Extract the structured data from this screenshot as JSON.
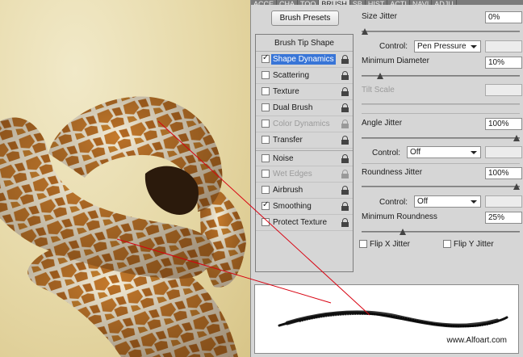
{
  "tabs": [
    "ACCE",
    "CHA",
    "TOO",
    "BRUSH",
    "SB",
    "HIST",
    "ACTI",
    "NAVI",
    "ADJU"
  ],
  "active_tab": "BRUSH",
  "brush_presets_label": "Brush Presets",
  "list": {
    "title": "Brush Tip Shape",
    "items": [
      {
        "label": "Shape Dynamics",
        "checked": true
      },
      {
        "label": "Scattering",
        "checked": false
      },
      {
        "label": "Texture",
        "checked": false
      },
      {
        "label": "Dual Brush",
        "checked": false
      },
      {
        "label": "Color Dynamics",
        "checked": false
      },
      {
        "label": "Transfer",
        "checked": false
      },
      {
        "label": "Noise",
        "checked": false
      },
      {
        "label": "Wet Edges",
        "checked": false
      },
      {
        "label": "Airbrush",
        "checked": false
      },
      {
        "label": "Smoothing",
        "checked": true
      },
      {
        "label": "Protect Texture",
        "checked": false
      }
    ]
  },
  "controls": {
    "size_jitter": {
      "label": "Size Jitter",
      "value": "0%",
      "slider": 0.0
    },
    "control_label": "Control:",
    "control_size": "Pen Pressure",
    "min_diameter": {
      "label": "Minimum Diameter",
      "value": "10%",
      "slider": 0.1
    },
    "tilt_scale": {
      "label": "Tilt Scale"
    },
    "angle_jitter": {
      "label": "Angle Jitter",
      "value": "100%",
      "slider": 1.0
    },
    "control_angle": "Off",
    "roundness_jitter": {
      "label": "Roundness Jitter",
      "value": "100%",
      "slider": 1.0
    },
    "control_roundness": "Off",
    "min_roundness": {
      "label": "Minimum Roundness",
      "value": "25%",
      "slider": 0.25
    },
    "flip_x": "Flip X Jitter",
    "flip_y": "Flip Y Jitter"
  },
  "watermark": "www.Alfoart.com",
  "colors": {
    "selection": "#3875d7",
    "annotation_line": "#d8000f"
  }
}
